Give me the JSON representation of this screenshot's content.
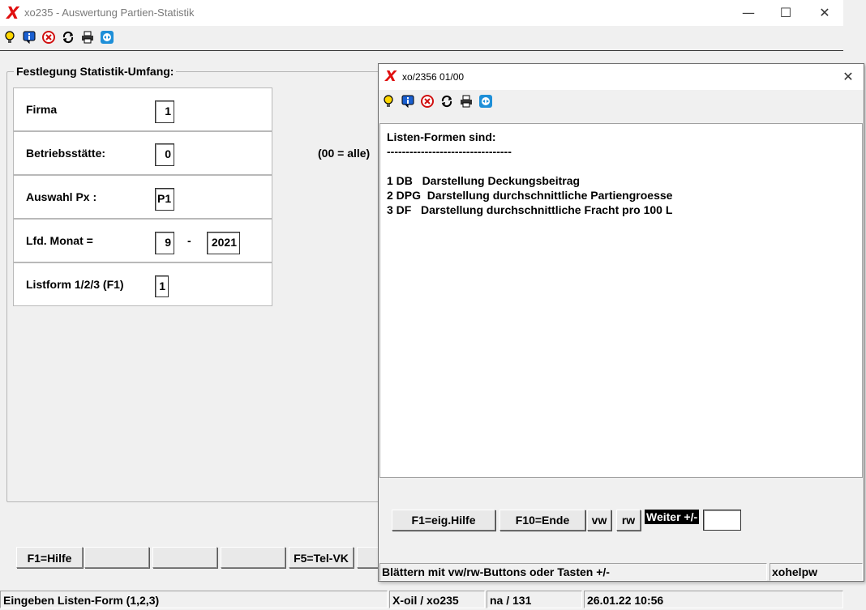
{
  "main_window": {
    "title": "xo235 - Auswertung Partien-Statistik",
    "logo": "X",
    "controls": {
      "minimize": "—",
      "maximize": "☐",
      "close": "✕"
    },
    "toolbar_icons": [
      "bulb-icon",
      "info-icon",
      "cancel-icon",
      "refresh-icon",
      "print-icon",
      "teamviewer-icon"
    ],
    "group_title": "Festlegung Statistik-Umfang:",
    "fields": {
      "firma": {
        "label": "Firma",
        "value": "1"
      },
      "betriebsstaette": {
        "label": "Betriebsstätte:",
        "value": "0",
        "hint": "(00 = alle)"
      },
      "auswahl_px": {
        "label": "Auswahl Px :",
        "value": "P1"
      },
      "lfd_monat": {
        "label": "Lfd. Monat =",
        "month": "9",
        "separator": "-",
        "year": "2021"
      },
      "listform": {
        "label": "Listform 1/2/3 (F1)",
        "value": "1"
      }
    },
    "function_keys": [
      "F1=Hilfe",
      "",
      "",
      "",
      "F5=Tel-VK"
    ],
    "status_bar": {
      "message": "Eingeben Listen-Form (1,2,3)",
      "app": "X-oil / xo235",
      "user": "na / 131",
      "datetime": "26.01.22 10:56"
    }
  },
  "dialog": {
    "title": "xo/2356 01/00",
    "logo": "X",
    "close": "✕",
    "toolbar_icons": [
      "bulb-icon",
      "info-icon",
      "cancel-icon",
      "refresh-icon",
      "print-icon",
      "teamviewer-icon"
    ],
    "lines": [
      "Listen-Formen sind:",
      "---------------------------------",
      "",
      "1 DB   Darstellung Deckungsbeitrag",
      "2 DPG  Darstellung durchschnittliche Partiengroesse",
      "3 DF   Darstellung durchschnittliche Fracht pro 100 L"
    ],
    "buttons": {
      "help": "F1=eig.Hilfe",
      "end": "F10=Ende",
      "vw": "vw",
      "rw": "rw"
    },
    "weiter_label": "Weiter +/-",
    "weiter_value": "",
    "status_message": "Blättern mit vw/rw-Buttons oder Tasten +/-",
    "status_program": "xohelpw"
  },
  "colors": {
    "logo_red": "#e01010",
    "window_bg": "#f0f0f0",
    "teamviewer_blue": "#1e8fd8"
  }
}
